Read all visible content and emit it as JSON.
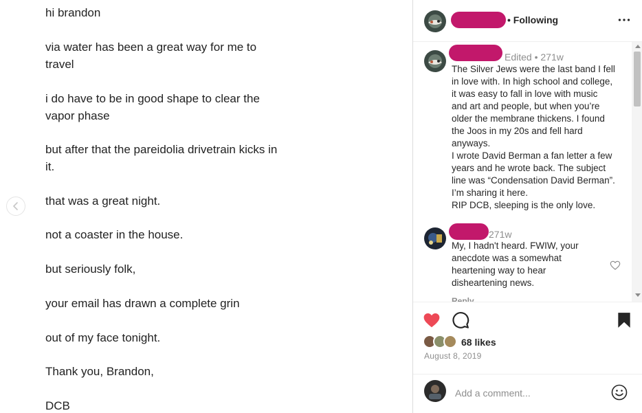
{
  "letter": {
    "lines": [
      "hi brandon",
      "via water has been a great way for me to",
      "travel",
      " i do have to be in good shape to clear the",
      "vapor phase",
      "but after that the pareidolia drivetrain kicks in",
      "it.",
      "that was a great night.",
      "not a coaster in the house.",
      "but seriously folk,",
      "your email has drawn a complete grin",
      "out of my face tonight.",
      "Thank you, Brandon,",
      "DCB"
    ]
  },
  "post": {
    "header": {
      "following_label": "• Following",
      "more_icon": "more-options-icon"
    },
    "comments": [
      {
        "meta": "Edited •  271w",
        "lines": [
          "The Silver Jews were the last band I fell",
          "in love with. In high school and college,",
          "it was easy to fall in love with music",
          "and art and people, but when you’re",
          "older the membrane thickens. I found",
          "the Joos in my 20s and fell hard",
          "anyways.",
          "I wrote David Berman a fan letter a few",
          "years and he wrote back. The subject",
          "line was “Condensation David Berman”.",
          "I’m sharing it here.",
          "RIP DCB, sleeping is the only love."
        ]
      },
      {
        "meta": "271w",
        "lines": [
          "My, I hadn't heard. FWIW, your",
          "anecdote was a somewhat",
          "heartening way to hear",
          "disheartening news."
        ],
        "reply_label": "Reply"
      }
    ],
    "likes": "68 likes",
    "date": "August 8, 2019",
    "add_comment_placeholder": "Add a comment...",
    "colors": {
      "like_red": "#ed4956",
      "redaction": "#c2186b"
    }
  }
}
